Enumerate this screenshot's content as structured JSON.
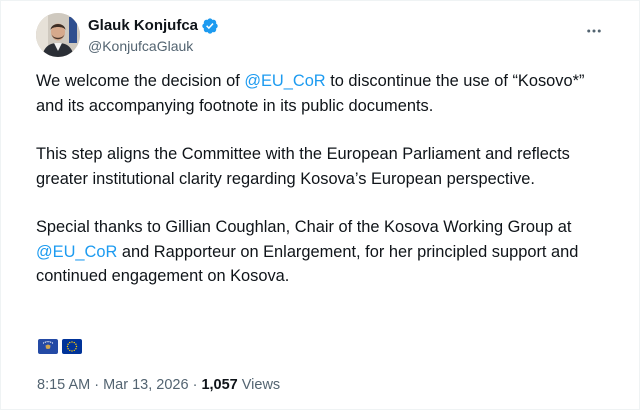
{
  "author": {
    "display_name": "Glauk Konjufca",
    "handle": "@KonjufcaGlauk"
  },
  "tweet": {
    "p1_pre": "We welcome the decision of ",
    "p1_mention": "@EU_CoR",
    "p1_post": " to discontinue the use of “Kosovo*” and its accompanying footnote in its public documents.",
    "p2": "This step aligns the Committee with the European Parliament and reflects greater institutional clarity regarding Kosova’s European perspective.",
    "p3_pre": "Special thanks to Gillian Coughlan, Chair of the Kosova Working Group at ",
    "p3_mention": "@EU_CoR",
    "p3_post": " and Rapporteur on Enlargement, for her principled support and continued engagement on Kosova.",
    "flags": [
      "kosovo-flag-icon",
      "eu-flag-icon"
    ]
  },
  "meta": {
    "time": "8:15 AM",
    "separator1": " · ",
    "date": "Mar 13, 2026",
    "separator2": " · ",
    "views_count": "1,057",
    "views_label": " Views"
  },
  "colors": {
    "text": "#0f1419",
    "secondary": "#536471",
    "link": "#1d9bf0",
    "verified": "#1d9bf0"
  }
}
